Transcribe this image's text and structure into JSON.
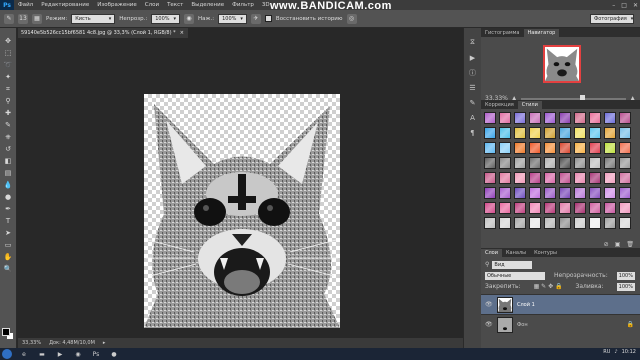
{
  "menu": {
    "logo": "Ps",
    "items": [
      "Файл",
      "Редактирование",
      "Изображение",
      "Слои",
      "Текст",
      "Выделение",
      "Фильтр",
      "3D"
    ]
  },
  "watermark": "www.BANDICAM.com",
  "options": {
    "mode_label": "Режим:",
    "mode_value": "Кисть",
    "opacity_label": "Непрозр.:",
    "opacity_value": "100%",
    "pressure_label": "Наж.:",
    "pressure_value": "100%",
    "history_label": "Восстановить историю",
    "brush_size": "13"
  },
  "workspace": "Фотография",
  "document": {
    "tab_title": "59140e5b526cc15bf6581 4c8.jpg @ 33,3% (Слой 1, RGB/8) *",
    "close": "×"
  },
  "status": {
    "zoom": "33,33%",
    "doc_size": "Док: 4,48M/10,0M"
  },
  "navigator": {
    "tabs": [
      "Гистограмма",
      "Навигатор"
    ],
    "zoom": "33.33%",
    "slider_fraction": 0.56
  },
  "styles": {
    "tabs": [
      "Коррекция",
      "Стили"
    ],
    "swatches": [
      "#b05fc9",
      "#e06ea3",
      "#7c6fd8",
      "#c86fb8",
      "#9c5ad0",
      "#8a3fb0",
      "#d36b8c",
      "#e86f9a",
      "#6e6ed8",
      "#b84f8f",
      "#3aa4e8",
      "#4fc2e9",
      "#e0c040",
      "#f0d050",
      "#d0a030",
      "#4da8e0",
      "#f0e060",
      "#60c8f0",
      "#e4a63a",
      "#7ac0e8",
      "#5fb8f0",
      "#8ad0f8",
      "#ef7b2b",
      "#ee5a2a",
      "#f5913c",
      "#d94830",
      "#f7b248",
      "#e04050",
      "#c0e040",
      "#f07050",
      "#606060",
      "#8a8a8a",
      "#a0a0a0",
      "#707070",
      "#b0b0b0",
      "#505050",
      "#909090",
      "#c0c0c0",
      "#787878",
      "#989898",
      "#c85a8a",
      "#e07aa0",
      "#f09ab8",
      "#b8408a",
      "#d868a8",
      "#c05090",
      "#e888b0",
      "#a83878",
      "#f0a0c0",
      "#d070a0",
      "#8f3fb8",
      "#a95fd0",
      "#6f4fc0",
      "#c070e0",
      "#9a5ac8",
      "#7a48b8",
      "#b878d8",
      "#8850c0",
      "#d090e8",
      "#a060d0",
      "#d24a8a",
      "#e86aa0",
      "#c04080",
      "#f088b8",
      "#b83878",
      "#e07aa8",
      "#a83070",
      "#d060a0",
      "#c858a0",
      "#f09ac0",
      "#c0c0c0",
      "#d8d8d8",
      "#a8a8a8",
      "#e8e8e8",
      "#b8b8b8",
      "#909090",
      "#cccccc",
      "#f0f0f0",
      "#a0a0a0",
      "#dadada"
    ]
  },
  "layers": {
    "tabs": [
      "Слои",
      "Каналы",
      "Контуры"
    ],
    "filter": "Вид",
    "blend": "Обычные",
    "opacity_label": "Непрозрачность:",
    "opacity_value": "100%",
    "lock_label": "Закрепить:",
    "fill_label": "Заливка:",
    "fill_value": "100%",
    "items": [
      {
        "name": "Слой 1",
        "selected": true,
        "locked": false
      },
      {
        "name": "Фон",
        "selected": false,
        "locked": true
      }
    ]
  },
  "taskbar": {
    "lang": "RU",
    "time": "10:12"
  }
}
